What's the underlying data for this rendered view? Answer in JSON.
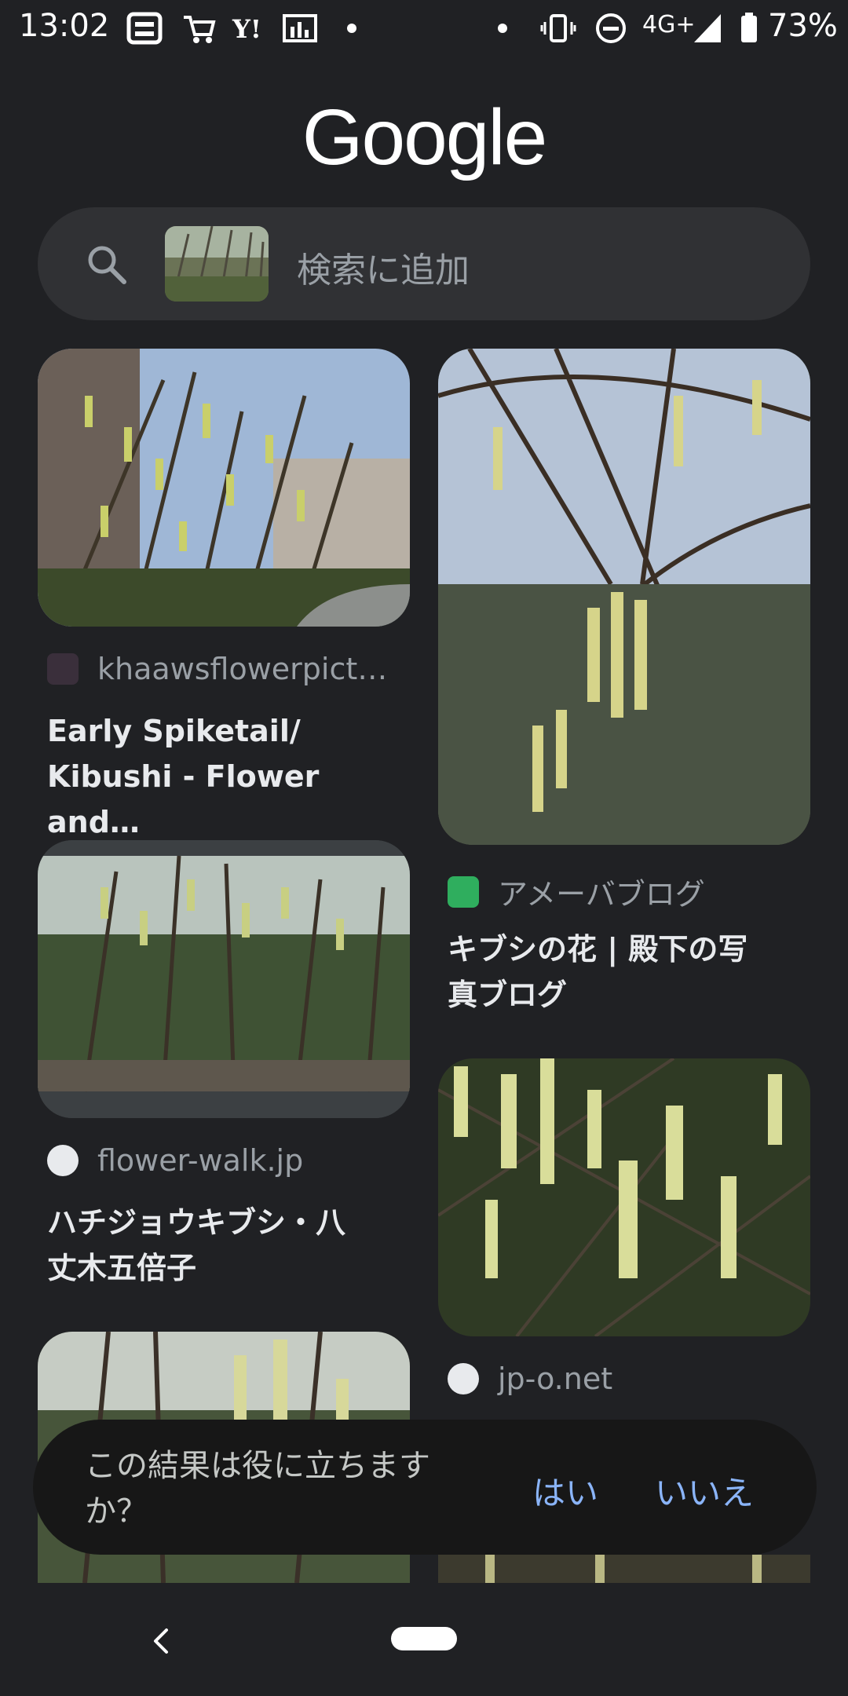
{
  "status_bar": {
    "time": "13:02",
    "network": "4G+",
    "battery": "73%"
  },
  "logo": "Google",
  "search": {
    "placeholder": "検索に追加"
  },
  "results": [
    {
      "source": "khaawsflowerpict…",
      "title_line1": "Early Spiketail/",
      "title_line2": "Kibushi - Flower and…"
    },
    {
      "source": "アメーバブログ",
      "title_line1": "キブシの花 | 殿下の写",
      "title_line2": "真ブログ"
    },
    {
      "source": "flower-walk.jp",
      "title_line1": "ハチジョウキブシ・八",
      "title_line2": "丈木五倍子"
    },
    {
      "source": "jp-o.net"
    }
  ],
  "feedback": {
    "question_line1": "この結果は役に立ちます",
    "question_line2": "か？",
    "yes": "はい",
    "no": "いいえ"
  },
  "icons": [
    "search-icon",
    "back-icon",
    "home-pill",
    "battery-icon",
    "signal-icon",
    "vibrate-icon",
    "dnd-icon"
  ]
}
